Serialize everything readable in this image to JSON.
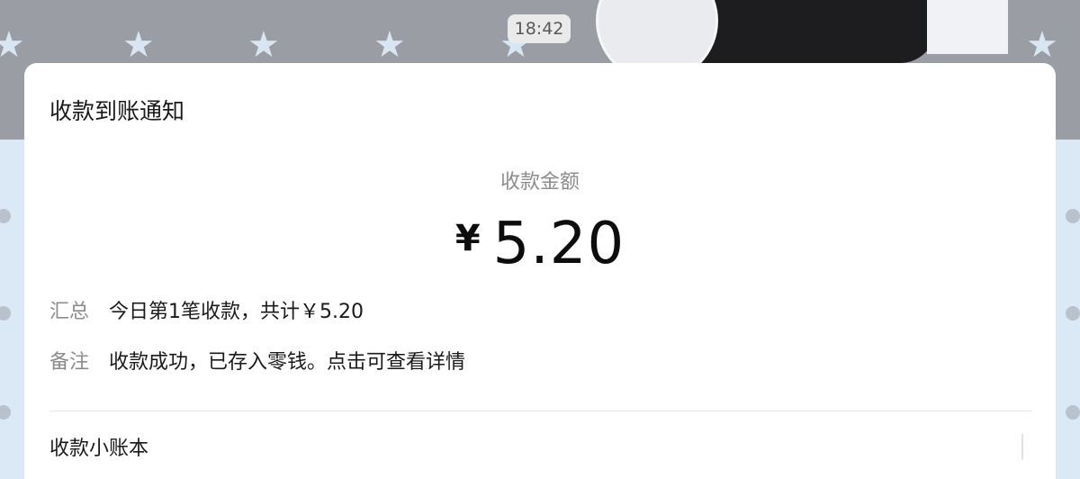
{
  "chat": {
    "timestamp": "18:42"
  },
  "card": {
    "title": "收款到账通知",
    "amount_label": "收款金额",
    "currency_symbol": "¥",
    "amount": "5.20",
    "summary": {
      "label": "汇总",
      "value": "今日第1笔收款，共计￥5.20"
    },
    "note": {
      "label": "备注",
      "value": "收款成功，已存入零钱。点击可查看详情"
    },
    "footer_link": "收款小账本"
  },
  "colors": {
    "card_background": "#ffffff",
    "muted_text": "#8c8c8c",
    "primary_text": "#1a1a1a"
  }
}
